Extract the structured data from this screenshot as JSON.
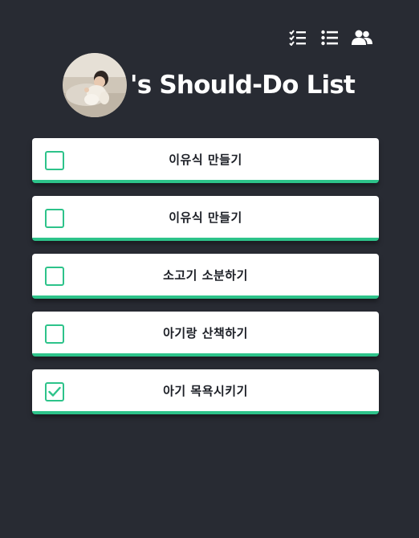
{
  "nav": {
    "icons": [
      "checklist-icon",
      "list-icon",
      "users-icon"
    ]
  },
  "header": {
    "title": "'s Should-Do List"
  },
  "colors": {
    "background": "#282b33",
    "accent": "#2dc38a",
    "card": "#ffffff",
    "text": "#1c1f26"
  },
  "todos": [
    {
      "label": "이유식 만들기",
      "checked": false
    },
    {
      "label": "이유식 만들기",
      "checked": false
    },
    {
      "label": "소고기 소분하기",
      "checked": false
    },
    {
      "label": "아기랑 산책하기",
      "checked": false
    },
    {
      "label": "아기 목욕시키기",
      "checked": true
    }
  ]
}
